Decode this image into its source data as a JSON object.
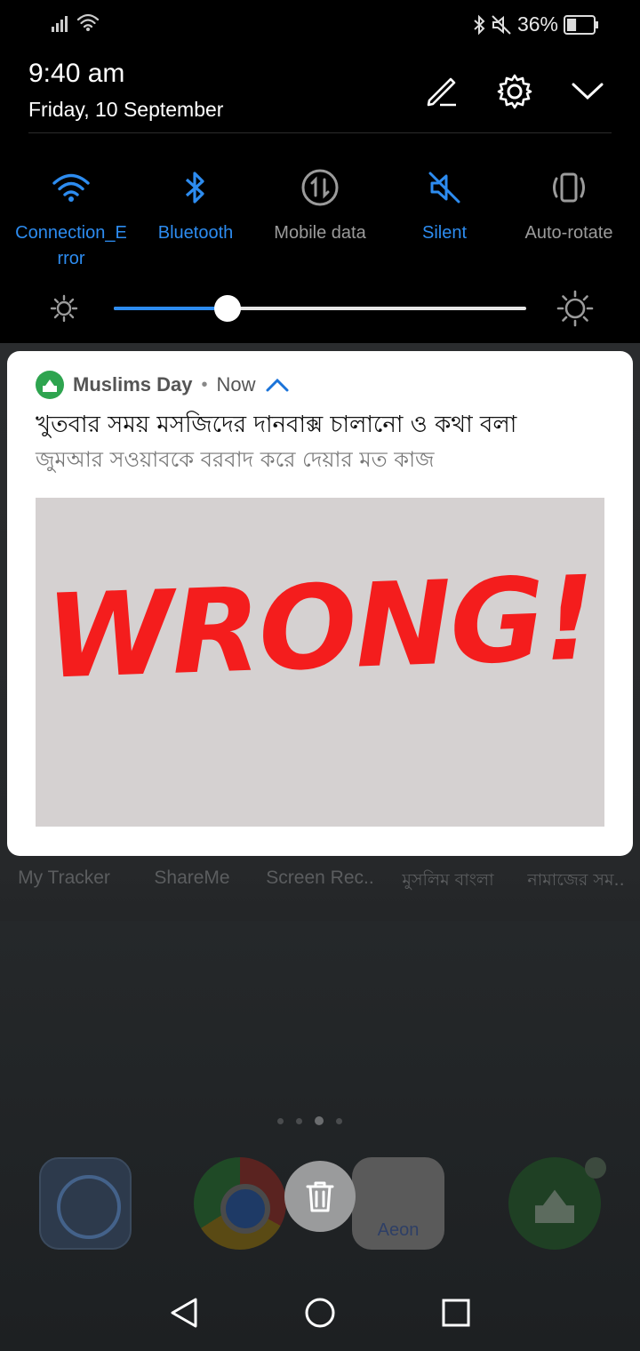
{
  "status_bar": {
    "battery_percent": "36%",
    "battery_level": 0.36,
    "icons": [
      "signal-icon",
      "wifi-icon",
      "bluetooth-icon",
      "mute-icon",
      "battery-icon"
    ]
  },
  "quick_settings": {
    "time": "9:40 am",
    "date": "Friday, 10 September",
    "actions": [
      "edit-icon",
      "settings-icon",
      "collapse-chevron-icon"
    ],
    "tiles": [
      {
        "label": "Connection_Error",
        "icon": "wifi-icon",
        "active": true
      },
      {
        "label": "Bluetooth",
        "icon": "bluetooth-icon",
        "active": true
      },
      {
        "label": "Mobile data",
        "icon": "mobile-data-icon",
        "active": false
      },
      {
        "label": "Silent",
        "icon": "silent-icon",
        "active": true
      },
      {
        "label": "Auto-rotate",
        "icon": "auto-rotate-icon",
        "active": false
      }
    ],
    "brightness_level": 0.275,
    "accent_color": "#2d8cf0"
  },
  "notification": {
    "app_name": "Muslims Day",
    "separator": "•",
    "time": "Now",
    "title": "খুতবার সময় মসজিদের দানবাক্স চালানো ও কথা বলা",
    "body": "জুমআর সওয়াবকে বরবাদ করে দেয়ার মত কাজ",
    "image_text": "WRONG!",
    "image_text_color": "#f41d1d",
    "image_bg_color": "#d5d1d1"
  },
  "home_screen": {
    "app_labels": [
      "My Tracker",
      "ShareMe",
      "Screen Rec..",
      "মুসলিম বাংলা",
      "নামাজের সম.."
    ],
    "dock": [
      {
        "name": "settings-app-icon"
      },
      {
        "name": "chrome-app-icon"
      },
      {
        "name": "aeon-app-icon",
        "label": "Aeon"
      },
      {
        "name": "mosque-app-icon"
      }
    ]
  },
  "nav_bar": [
    "back-icon",
    "home-icon",
    "recents-icon"
  ]
}
